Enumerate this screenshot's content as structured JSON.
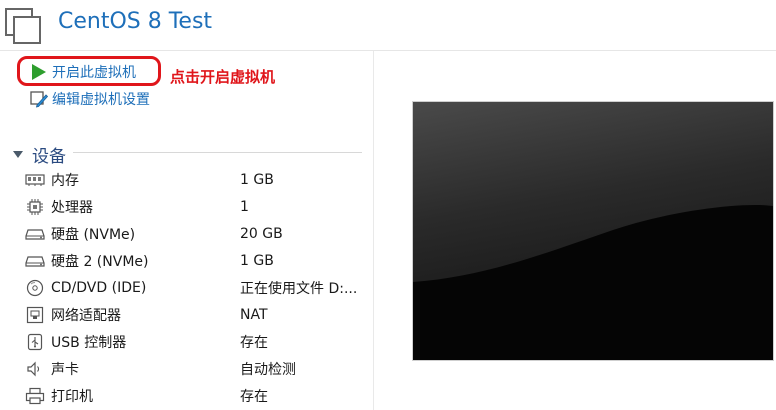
{
  "header": {
    "title": "CentOS 8 Test"
  },
  "actions": {
    "power_on_label": "开启此虚拟机",
    "edit_settings_label": "编辑虚拟机设置"
  },
  "annotation": {
    "text": "点击开启虚拟机",
    "color": "#e0161b"
  },
  "devices": {
    "section_label": "设备",
    "items": [
      {
        "icon": "memory-icon",
        "name": "内存",
        "value": "1 GB"
      },
      {
        "icon": "processor-icon",
        "name": "处理器",
        "value": "1"
      },
      {
        "icon": "hard-disk-icon",
        "name": "硬盘 (NVMe)",
        "value": "20 GB"
      },
      {
        "icon": "hard-disk-icon",
        "name": "硬盘 2 (NVMe)",
        "value": "1 GB"
      },
      {
        "icon": "cd-dvd-icon",
        "name": "CD/DVD (IDE)",
        "value": "正在使用文件 D:..."
      },
      {
        "icon": "network-adapter-icon",
        "name": "网络适配器",
        "value": "NAT"
      },
      {
        "icon": "usb-controller-icon",
        "name": "USB 控制器",
        "value": "存在"
      },
      {
        "icon": "sound-card-icon",
        "name": "声卡",
        "value": "自动检测"
      },
      {
        "icon": "printer-icon",
        "name": "打印机",
        "value": "存在"
      }
    ]
  },
  "colors": {
    "accent": "#1e6fb9",
    "play_green": "#2e9e2e",
    "highlight_red": "#e0161b"
  }
}
